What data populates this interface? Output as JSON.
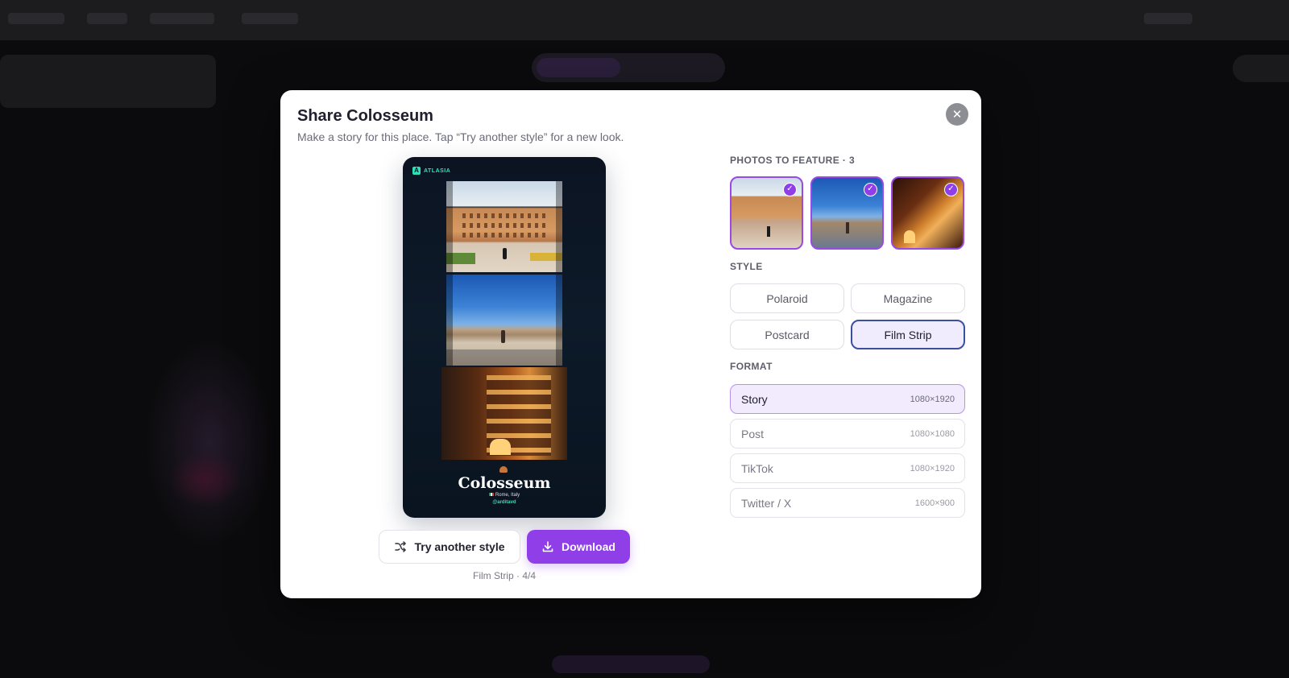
{
  "modal": {
    "title": "Share Colosseum",
    "subtitle": "Make a story for this place. Tap “Try another style” for a new look.",
    "close_icon": "close-icon"
  },
  "preview": {
    "brand": "ATLASIA",
    "brand_icon": "A",
    "place_name": "Colosseum",
    "location": "Rome, Italy",
    "handle": "@arditavd"
  },
  "actions": {
    "try_label": "Try another style",
    "try_icon": "shuffle-icon",
    "download_label": "Download",
    "download_icon": "download-icon",
    "counter": "Film Strip · 4/4"
  },
  "photos": {
    "label": "PHOTOS TO FEATURE · 3",
    "items": [
      {
        "name": "colosseum-exterior-day",
        "selected": true
      },
      {
        "name": "colosseum-interior",
        "selected": true
      },
      {
        "name": "colosseum-night",
        "selected": true
      }
    ]
  },
  "style": {
    "label": "STYLE",
    "options": [
      "Polaroid",
      "Magazine",
      "Postcard",
      "Film Strip"
    ],
    "selected": "Film Strip"
  },
  "format": {
    "label": "FORMAT",
    "options": [
      {
        "name": "Story",
        "size": "1080×1920"
      },
      {
        "name": "Post",
        "size": "1080×1080"
      },
      {
        "name": "TikTok",
        "size": "1080×1920"
      },
      {
        "name": "Twitter / X",
        "size": "1600×900"
      }
    ],
    "selected": "Story"
  },
  "colors": {
    "accent": "#8f3ee8",
    "selected_style_border": "#3a4fa0",
    "brand_teal": "#2ee0b8"
  }
}
